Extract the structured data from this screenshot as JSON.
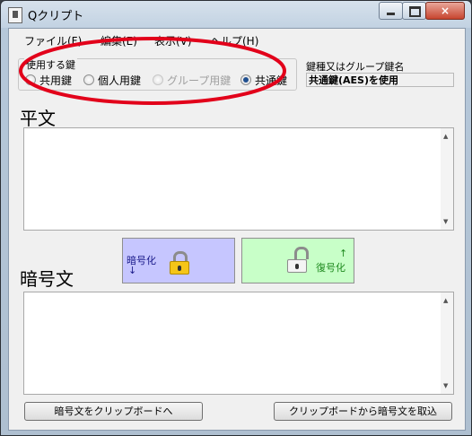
{
  "window": {
    "title": "Qクリプト",
    "controls": {
      "minimize": "minimize",
      "maximize": "maximize",
      "close": "×"
    }
  },
  "menu": {
    "items": [
      "ファイル(F)",
      "編集(E)",
      "表示(V)",
      "ヘルプ(H)"
    ]
  },
  "key_group": {
    "legend": "使用する鍵",
    "options": [
      {
        "label": "共用鍵",
        "selected": false,
        "enabled": true
      },
      {
        "label": "個人用鍵",
        "selected": false,
        "enabled": true
      },
      {
        "label": "グループ用鍵",
        "selected": false,
        "enabled": false
      },
      {
        "label": "共通鍵",
        "selected": true,
        "enabled": true
      }
    ],
    "highlight_color": "#e2001a"
  },
  "key_info": {
    "label": "鍵種又はグループ鍵名",
    "value": "共通鍵(AES)を使用"
  },
  "plaintext": {
    "title": "平文",
    "value": ""
  },
  "ciphertext": {
    "title": "暗号文",
    "value": ""
  },
  "actions": {
    "encrypt": {
      "label": "暗号化",
      "arrow": "↓",
      "color": "#c6c6ff",
      "lock_color": "#f5c518"
    },
    "decrypt": {
      "label": "復号化",
      "arrow": "↑",
      "color": "#c8ffc8",
      "lock_color": "#f4f4f4"
    },
    "copy_to_clipboard": "暗号文をクリップボードへ",
    "paste_from_clipboard": "クリップボードから暗号文を取込"
  }
}
